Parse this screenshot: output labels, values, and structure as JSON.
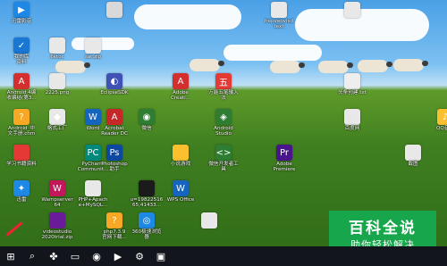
{
  "desktop_icons": [
    {
      "label": "迅雷影音",
      "icon": "player-icon",
      "color": "#1e88e5",
      "glyph": "▶"
    },
    {
      "label": "",
      "icon": "file-icon",
      "color": "#d9d9d9",
      "glyph": ""
    },
    {
      "label": "hepveovisd\ntext",
      "icon": "file-icon",
      "color": "#e8e8e8",
      "glyph": ""
    },
    {
      "label": "",
      "icon": "file-icon",
      "color": "#e8e8e8",
      "glyph": ""
    },
    {
      "label": "我的库\n资料",
      "icon": "folder-icon",
      "color": "#1976d2",
      "glyph": "✓"
    },
    {
      "label": "6ktoc",
      "icon": "file-icon",
      "color": "#e8e8e8",
      "glyph": ""
    },
    {
      "label": "sat.zip",
      "icon": "zip-icon",
      "color": "#e8e8e8",
      "glyph": ""
    },
    {
      "label": "Android 4编\n收编结(第3...",
      "icon": "pdf-icon",
      "color": "#d32f2f",
      "glyph": "A"
    },
    {
      "label": "2225.png",
      "icon": "image-icon",
      "color": "#e8e8e8",
      "glyph": ""
    },
    {
      "label": "EclipseSDK",
      "icon": "eclipse-icon",
      "color": "#3f51b5",
      "glyph": "◐"
    },
    {
      "label": "Adobe\nCreati...",
      "icon": "adobe-icon",
      "color": "#d32f2f",
      "glyph": "A"
    },
    {
      "label": "万能五笔输入\n法",
      "icon": "ime-icon",
      "color": "#e53935",
      "glyph": "五"
    },
    {
      "label": "头条创建.txt",
      "icon": "text-icon",
      "color": "#eeeeee",
      "glyph": ""
    },
    {
      "label": "Android_中\n文手册.chm",
      "icon": "chm-icon",
      "color": "#f9a825",
      "glyph": "?"
    },
    {
      "label": "格式工厂",
      "icon": "format-factory-icon",
      "color": "#e8e8e8",
      "glyph": "◆"
    },
    {
      "label": "Word",
      "icon": "word-icon",
      "color": "#1565c0",
      "glyph": "W"
    },
    {
      "label": "Acrobat\nReader DC",
      "icon": "acrobat-icon",
      "color": "#c62828",
      "glyph": "A"
    },
    {
      "label": "微信",
      "icon": "wechat-icon",
      "color": "#2e7d32",
      "glyph": "◉"
    },
    {
      "label": "Android\nStudio",
      "icon": "android-studio-icon",
      "color": "#2e7d32",
      "glyph": "◈"
    },
    {
      "label": "百度网",
      "icon": "baidu-icon",
      "color": "#e8e8e8",
      "glyph": ""
    },
    {
      "label": "QQ音乐",
      "icon": "qqmusic-icon",
      "color": "#fbc02d",
      "glyph": "♪"
    },
    {
      "label": "学习书籍资料",
      "icon": "folder-icon",
      "color": "#e53935",
      "glyph": ""
    },
    {
      "label": "PyCharm\nCommunit...",
      "icon": "pycharm-icon",
      "color": "#00897b",
      "glyph": "PC"
    },
    {
      "label": "Photoshop\n助手",
      "icon": "photoshop-icon",
      "color": "#0d47a1",
      "glyph": "Ps"
    },
    {
      "label": "小说游戏",
      "icon": "folder-icon",
      "color": "#fbc02d",
      "glyph": ""
    },
    {
      "label": "微信开发者工\n具",
      "icon": "devtools-icon",
      "color": "#2e7d32",
      "glyph": "<>"
    },
    {
      "label": "Adobe\nPremiere",
      "icon": "premiere-icon",
      "color": "#4a148c",
      "glyph": "Pr"
    },
    {
      "label": "截图",
      "icon": "folder-icon",
      "color": "#e8e8e8",
      "glyph": ""
    },
    {
      "label": "迅雷",
      "icon": "thunder-icon",
      "color": "#1e88e5",
      "glyph": "✦"
    },
    {
      "label": "Wampserver\n64",
      "icon": "wamp-icon",
      "color": "#c2185b",
      "glyph": "W"
    },
    {
      "label": "PHP+Apach\ne+MySQL...",
      "icon": "folder-icon",
      "color": "#e8e8e8",
      "glyph": ""
    },
    {
      "label": "u=19822516\n65,41433...",
      "icon": "image-icon",
      "color": "#1b1b1b",
      "glyph": ""
    },
    {
      "label": "WPS Office",
      "icon": "wps-icon",
      "color": "#1565c0",
      "glyph": "W"
    },
    {
      "label": "videostudio\n2020trial.zip",
      "icon": "zip-icon",
      "color": "#6a1b9a",
      "glyph": ""
    },
    {
      "label": "php7.3.9\n官网下载...",
      "icon": "help-icon",
      "color": "#f9a825",
      "glyph": "?"
    },
    {
      "label": "360极速浏览\n器",
      "icon": "browser-360-icon",
      "color": "#1e88e5",
      "glyph": "◎"
    },
    {
      "label": "",
      "icon": "file-icon",
      "color": "#e8e8e8",
      "glyph": ""
    }
  ],
  "taskbar": [
    {
      "name": "start-button",
      "icon": "windows-icon",
      "glyph": "⊞"
    },
    {
      "name": "search-button",
      "icon": "search-icon",
      "glyph": "⌕"
    },
    {
      "name": "pinwheel-app",
      "icon": "pinwheel-icon",
      "glyph": "✤"
    },
    {
      "name": "explorer-app",
      "icon": "folder-icon",
      "glyph": "▭"
    },
    {
      "name": "firefox-app",
      "icon": "firefox-icon",
      "glyph": "◉"
    },
    {
      "name": "media-app",
      "icon": "media-icon",
      "glyph": "▶"
    },
    {
      "name": "settings-app",
      "icon": "gear-icon",
      "glyph": "⚙"
    },
    {
      "name": "store-app",
      "icon": "store-icon",
      "glyph": "▣"
    }
  ],
  "watermark": {
    "title": "百科全说",
    "subtitle": "助你轻松解决"
  }
}
